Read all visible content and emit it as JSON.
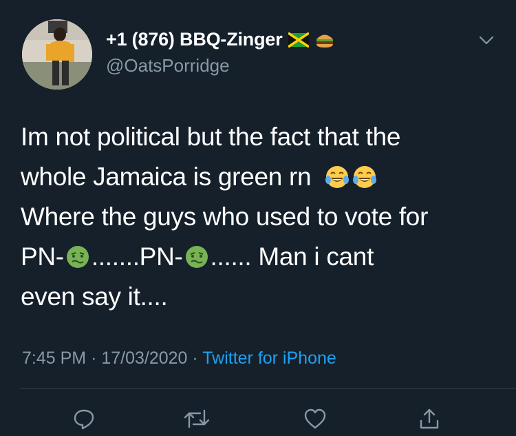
{
  "tweet": {
    "display_name": "+1 (876) BBQ-Zinger",
    "name_emojis": [
      "jamaica-flag-icon",
      "hamburger-icon"
    ],
    "handle": "@OatsPorridge",
    "text_lines": [
      "Im not political but the fact that the",
      "whole Jamaica is green rn",
      "Where the guys who used to vote for",
      "PN-",
      ".......PN-",
      "...... Man i cant",
      "even say it...."
    ],
    "time": "7:45 PM",
    "date": "17/03/2020",
    "separator": "·",
    "source": "Twitter for iPhone"
  },
  "actions": [
    "reply-icon",
    "retweet-icon",
    "like-icon",
    "share-icon"
  ],
  "colors": {
    "background": "#15202b",
    "text": "#ffffff",
    "secondary": "#8899a6",
    "link": "#1da1f2",
    "divider": "#38444d"
  }
}
